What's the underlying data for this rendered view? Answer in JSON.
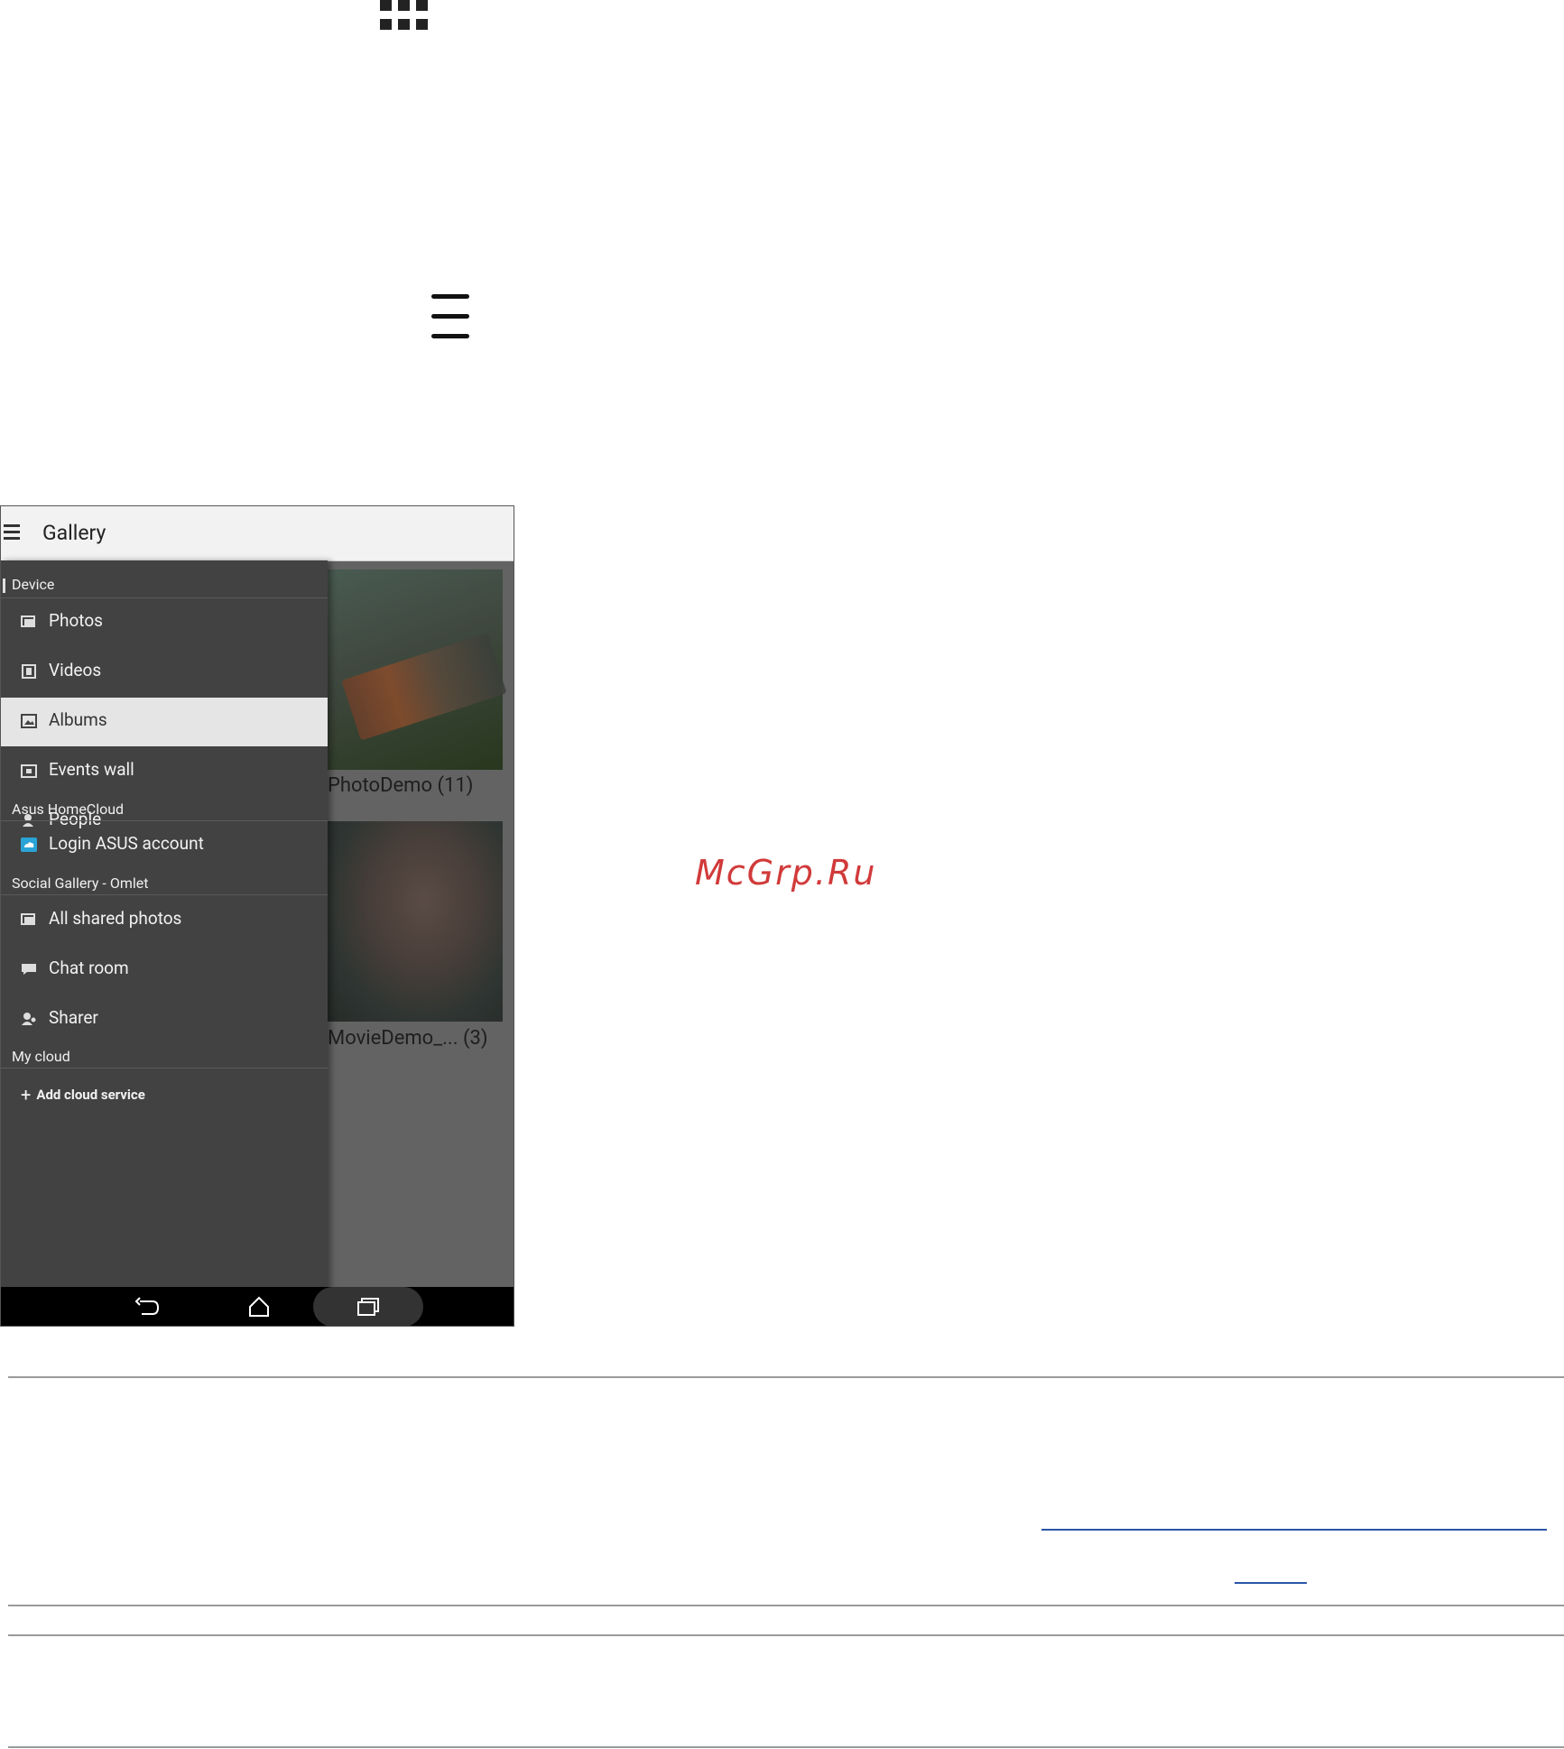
{
  "phone": {
    "app_title": "Gallery",
    "sections": {
      "device": "Device",
      "homecloud": "Asus HomeCloud",
      "social": "Social Gallery - Omlet",
      "mycloud": "My cloud"
    },
    "device_items": [
      {
        "label": "Photos",
        "icon": "photos-icon"
      },
      {
        "label": "Videos",
        "icon": "videos-icon"
      },
      {
        "label": "Albums",
        "icon": "albums-icon",
        "selected": true
      },
      {
        "label": "Events wall",
        "icon": "events-icon"
      },
      {
        "label": "People",
        "icon": "people-icon"
      }
    ],
    "homecloud_items": [
      {
        "label": "Login ASUS account",
        "icon": "cloud-icon"
      }
    ],
    "social_items": [
      {
        "label": "All shared photos",
        "icon": "shared-photos-icon"
      },
      {
        "label": "Chat room",
        "icon": "chat-icon"
      },
      {
        "label": "Sharer",
        "icon": "sharer-icon"
      }
    ],
    "add_cloud": "Add cloud service",
    "albums": [
      {
        "caption": "PhotoDemo (11)"
      },
      {
        "caption": "MovieDemo_...  (3)"
      }
    ],
    "navbar": [
      "back-icon",
      "home-icon",
      "recents-icon"
    ]
  },
  "watermark": "McGrp.Ru",
  "colors": {
    "drawer_bg": "#424242",
    "selected_bg": "#e5e5e5",
    "watermark": "#d13a3a",
    "link": "#2a56a8"
  }
}
